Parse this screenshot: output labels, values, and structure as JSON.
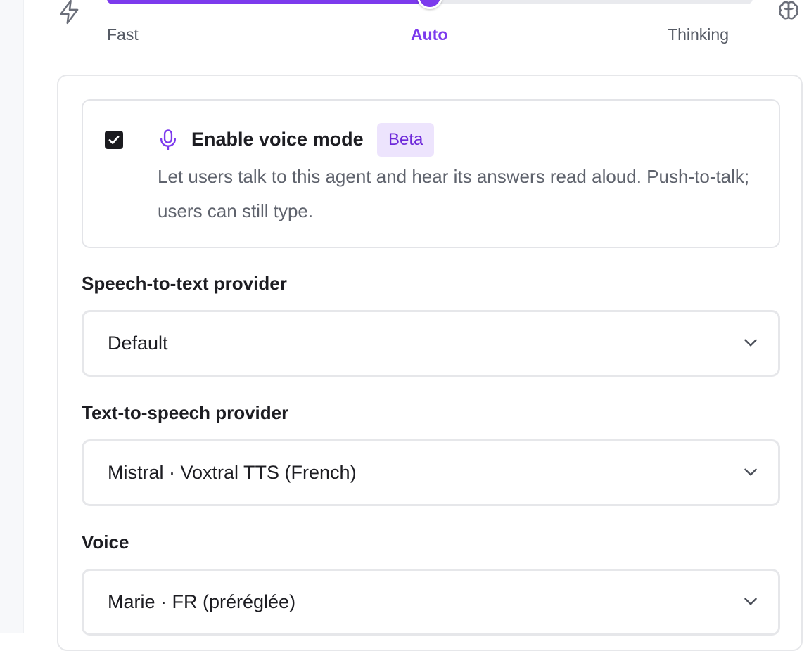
{
  "speed": {
    "labels": {
      "fast": "Fast",
      "auto": "Auto",
      "thinking": "Thinking"
    },
    "selected": "Auto",
    "value_fraction": 0.5,
    "accent": "#7c3aed",
    "icons": {
      "left": "lightning-icon",
      "right": "brain-icon"
    }
  },
  "voice_mode": {
    "checked": true,
    "title": "Enable voice mode",
    "badge": "Beta",
    "description": "Let users talk to this agent and hear its answers read aloud. Push-to-talk; users can still type.",
    "icon": "microphone-icon"
  },
  "fields": {
    "stt": {
      "label": "Speech-to-text provider",
      "value": "Default"
    },
    "tts": {
      "label": "Text-to-speech provider",
      "value": "Mistral · Voxtral TTS (French)"
    },
    "voice": {
      "label": "Voice",
      "value": "Marie · FR (préréglée)"
    }
  }
}
